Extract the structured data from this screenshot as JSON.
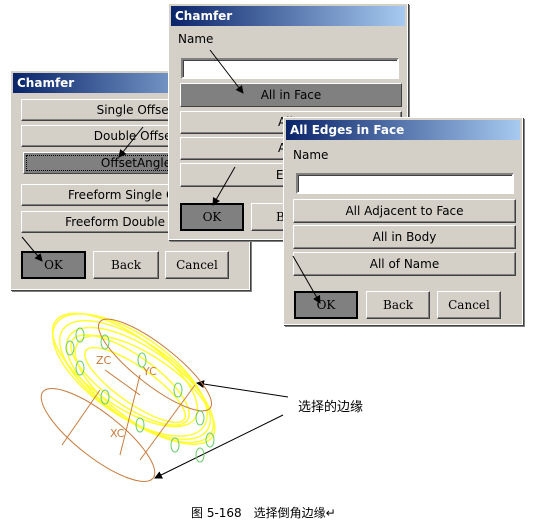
{
  "dialog1": {
    "title": "Chamfer",
    "options": [
      "Single Offset",
      "Double Offset",
      "OffsetAngle",
      "Freeform Single Offset",
      "Freeform Double Offset"
    ],
    "ok": "OK",
    "back": "Back",
    "cancel": "Cancel"
  },
  "dialog2": {
    "title": "Chamfer",
    "name_label": "Name",
    "name_value": "",
    "options": [
      "All in Face",
      "All o",
      "All o",
      "Edge"
    ],
    "ok": "OK",
    "back": "Ba"
  },
  "dialog3": {
    "title": "All Edges in Face",
    "name_label": "Name",
    "name_value": "",
    "options": [
      "All Adjacent to Face",
      "All in Body",
      "All of Name"
    ],
    "ok": "OK",
    "back": "Back",
    "cancel": "Cancel"
  },
  "graphic": {
    "axis_labels": [
      "ZC",
      "YC",
      "XC"
    ],
    "annotation": "选择的边缘",
    "colors": {
      "selected_edges": "#ffff33",
      "edges": "#c87a3c",
      "holes": "#66cc66"
    }
  },
  "caption": "图 5-168　选择倒角边缘↵"
}
